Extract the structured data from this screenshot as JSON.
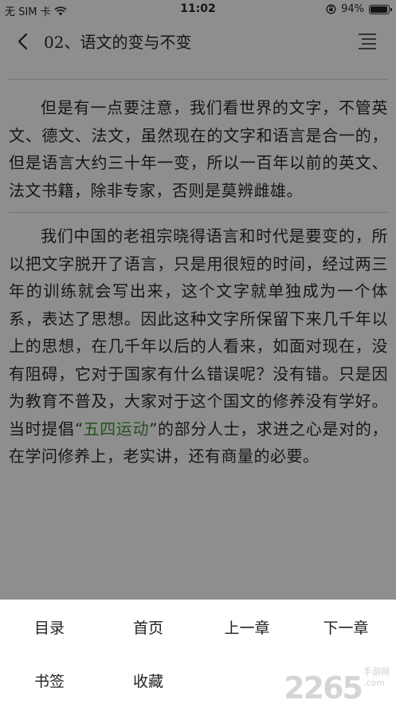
{
  "status_bar": {
    "carrier": "无 SIM 卡",
    "time": "11:02",
    "battery": "94%",
    "battery_level": 0.94
  },
  "nav": {
    "title": "02、语文的变与不变"
  },
  "content": {
    "paragraph1": "但是有一点要注意，我们看世界的文字，不管英文、德文、法文，虽然现在的文字和语言是合一的，但是语言大约三十年一变，所以一百年以前的英文、法文书籍，除非专家，否则是莫辨雌雄。",
    "paragraph2_before": "我们中国的老祖宗晓得语言和时代是要变的，所以把文字脱开了语言，只是用很短的时间，经过两三年的训练就会写出来，这个文字就单独成为一个体系，表达了思想。因此这种文字所保留下来几千年以上的思想，在几千年以后的人看来，如面对现在，没有阻碍，它对于国家有什么错误呢？没有错。只是因为教育不普及，大家对于这个国文的修养没有学好。当时提倡“",
    "paragraph2_link": "五四运动",
    "paragraph2_after": "”的部分人士，求进之心是对的，在学问修养上，老实讲，还有商量的必要。"
  },
  "bottom_menu": {
    "toc": "目录",
    "home": "首页",
    "prev_chapter": "上一章",
    "next_chapter": "下一章",
    "bookmark": "书签",
    "favorite": "收藏"
  },
  "watermark": {
    "number": "2265",
    "suffix": ".com",
    "label": "手游网"
  },
  "colors": {
    "overlay_background": "#8e8e8e",
    "highlight": "#24521e",
    "menu_background": "#ffffff"
  }
}
